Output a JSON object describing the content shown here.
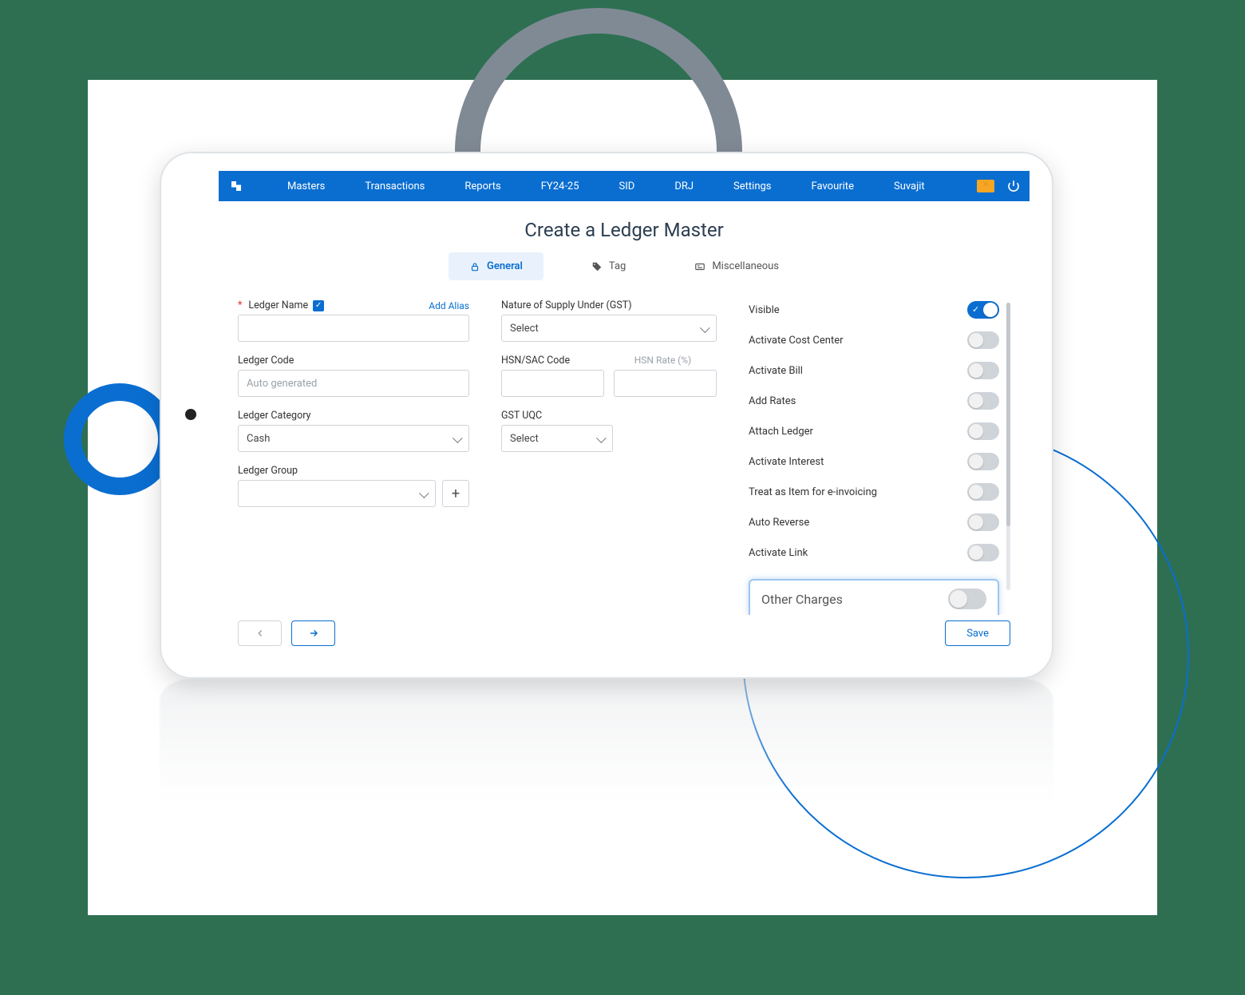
{
  "colors": {
    "brand": "#0a6ed1",
    "accent_mail": "#f6a623"
  },
  "nav": {
    "items": [
      "Masters",
      "Transactions",
      "Reports",
      "FY24-25",
      "SID",
      "DRJ",
      "Settings",
      "Favourite",
      "Suvajit"
    ]
  },
  "page_title": "Create a Ledger Master",
  "tabs": {
    "general": "General",
    "tag": "Tag",
    "misc": "Miscellaneous"
  },
  "left": {
    "ledger_name_label": "Ledger Name",
    "add_alias": "Add Alias",
    "ledger_code_label": "Ledger Code",
    "ledger_code_placeholder": "Auto generated",
    "ledger_category_label": "Ledger Category",
    "ledger_category_value": "Cash",
    "ledger_group_label": "Ledger Group"
  },
  "mid": {
    "nature_label": "Nature of Supply Under (GST)",
    "nature_value": "Select",
    "hsn_label": "HSN/SAC Code",
    "hsn_rate_label": "HSN Rate (%)",
    "gst_uqc_label": "GST UQC",
    "gst_uqc_value": "Select"
  },
  "toggles": [
    {
      "label": "Visible",
      "on": true
    },
    {
      "label": "Activate Cost Center",
      "on": false
    },
    {
      "label": "Activate Bill",
      "on": false
    },
    {
      "label": "Add Rates",
      "on": false
    },
    {
      "label": "Attach Ledger",
      "on": false
    },
    {
      "label": "Activate Interest",
      "on": false
    },
    {
      "label": "Treat as Item for e-invoicing",
      "on": false
    },
    {
      "label": "Auto Reverse",
      "on": false
    },
    {
      "label": "Activate Link",
      "on": false
    }
  ],
  "highlight_toggle": {
    "label": "Other Charges",
    "on": false
  },
  "footer": {
    "save": "Save"
  }
}
